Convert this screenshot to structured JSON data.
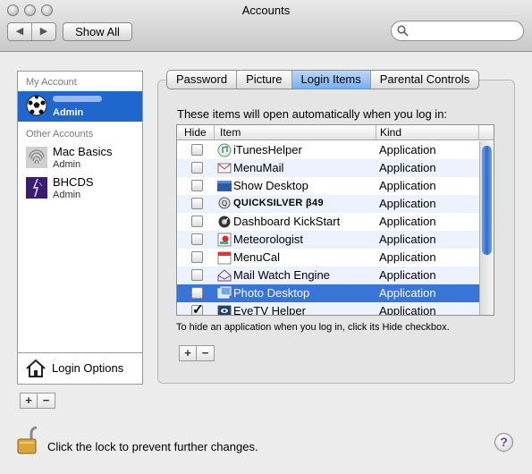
{
  "window": {
    "title": "Accounts"
  },
  "toolbar": {
    "back_label": "◀",
    "forward_label": "▶",
    "show_all_label": "Show All",
    "search_value": ""
  },
  "sidebar": {
    "my_account_header": "My Account",
    "my_account": {
      "name": "",
      "role": "Admin"
    },
    "other_accounts_header": "Other Accounts",
    "other_accounts": [
      {
        "name": "Mac Basics",
        "role": "Admin"
      },
      {
        "name": "BHCDS",
        "role": "Admin"
      }
    ],
    "login_options_label": "Login Options",
    "add_label": "+",
    "remove_label": "−"
  },
  "tabs": [
    {
      "label": "Password",
      "active": false
    },
    {
      "label": "Picture",
      "active": false
    },
    {
      "label": "Login Items",
      "active": true
    },
    {
      "label": "Parental Controls",
      "active": false
    }
  ],
  "login_items": {
    "intro": "These items will open automatically when you log in:",
    "columns": {
      "hide": "Hide",
      "item": "Item",
      "kind": "Kind"
    },
    "rows": [
      {
        "name": "iTunesHelper",
        "kind": "Application",
        "hidden": false,
        "icon": "itunes-icon"
      },
      {
        "name": "MenuMail",
        "kind": "Application",
        "hidden": false,
        "icon": "menumail-icon"
      },
      {
        "name": "Show Desktop",
        "kind": "Application",
        "hidden": false,
        "icon": "desktop-icon"
      },
      {
        "name": "QUICKSILVER β49",
        "kind": "Application",
        "hidden": false,
        "icon": "quicksilver-icon"
      },
      {
        "name": "Dashboard KickStart",
        "kind": "Application",
        "hidden": false,
        "icon": "dashboard-icon"
      },
      {
        "name": "Meteorologist",
        "kind": "Application",
        "hidden": false,
        "icon": "meteorologist-icon"
      },
      {
        "name": "MenuCal",
        "kind": "Application",
        "hidden": false,
        "icon": "menucal-icon"
      },
      {
        "name": "Mail Watch Engine",
        "kind": "Application",
        "hidden": false,
        "icon": "mail-watch-icon"
      },
      {
        "name": "Photo Desktop",
        "kind": "Application",
        "hidden": false,
        "icon": "photo-desktop-icon"
      },
      {
        "name": "EyeTV Helper",
        "kind": "Application",
        "hidden": true,
        "icon": "eyetv-icon"
      }
    ],
    "selected_row": 8,
    "hint": "To hide an application when you log in, click its Hide checkbox.",
    "add_label": "+",
    "remove_label": "−"
  },
  "footer": {
    "lock_text": "Click the lock to prevent further changes.",
    "help_label": "?"
  }
}
